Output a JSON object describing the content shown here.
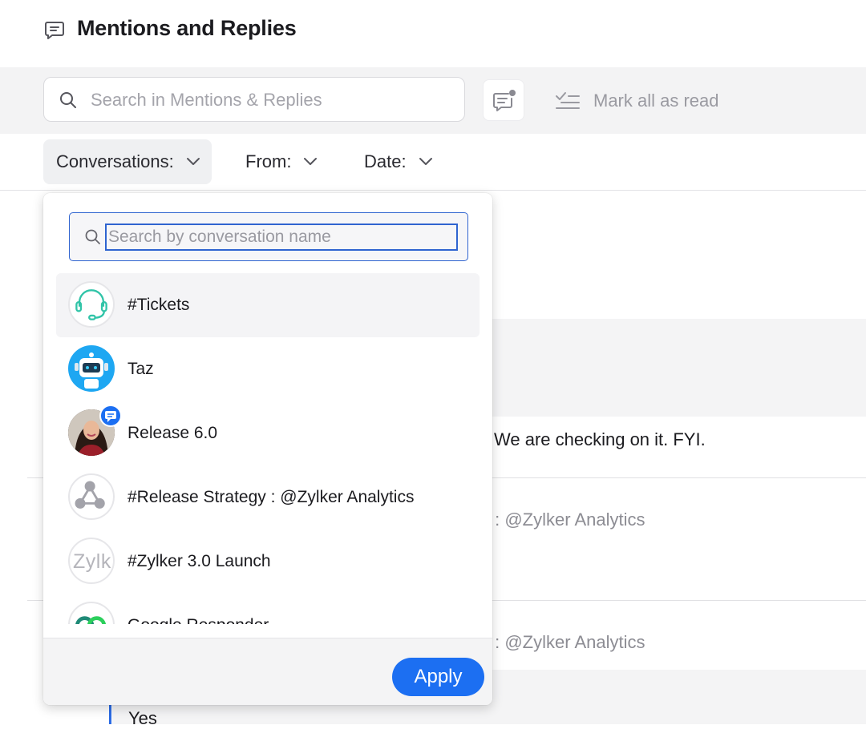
{
  "header": {
    "title": "Mentions and Replies",
    "icon": "chat-bubble-icon"
  },
  "toolbar": {
    "search_placeholder": "Search in Mentions & Replies",
    "mark_all_read_label": "Mark all as read"
  },
  "filters": {
    "conversations_label": "Conversations:",
    "from_label": "From:",
    "date_label": "Date:"
  },
  "background": {
    "message_text": "We are checking on it. FYI.",
    "source_1": "y : @Zylker Analytics",
    "source_2": "y : @Zylker Analytics",
    "reply_text": "Yes"
  },
  "dropdown": {
    "search_placeholder": "Search by conversation name",
    "items": [
      {
        "label": "#Tickets",
        "icon": "headset-icon",
        "selected": true
      },
      {
        "label": "Taz",
        "icon": "robot-icon",
        "selected": false
      },
      {
        "label": "Release 6.0",
        "icon": "user-photo",
        "selected": false
      },
      {
        "label": "#Release Strategy : @Zylker Analytics",
        "icon": "team-icon",
        "selected": false
      },
      {
        "label": "#Zylker 3.0 Launch",
        "icon": "zylker-logo",
        "logo_text": "Zylk",
        "selected": false
      },
      {
        "label": "Google Responder",
        "icon": "google-responder-icon",
        "selected": false
      }
    ],
    "apply_label": "Apply"
  },
  "colors": {
    "accent": "#1c6ff2",
    "focus_border": "#2f64d0",
    "band": "#f3f3f4"
  }
}
